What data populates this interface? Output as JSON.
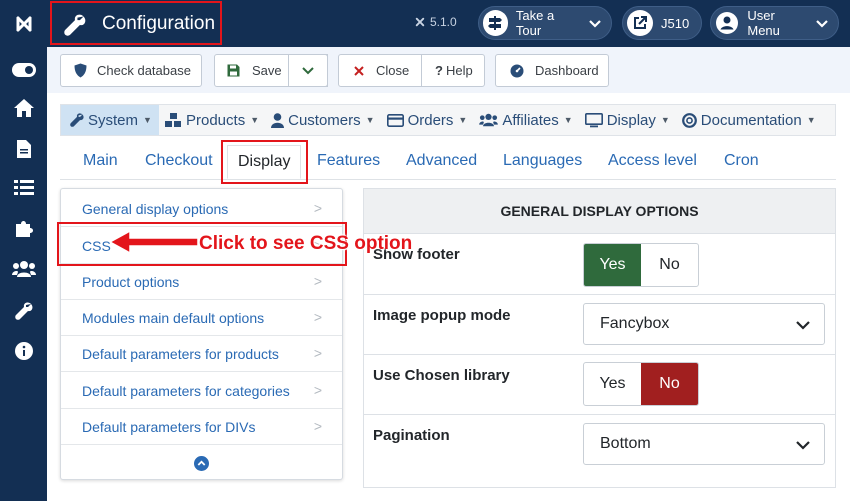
{
  "header": {
    "title": "Configuration",
    "version": "5.1.0",
    "take_tour": "Take a Tour",
    "site_name": "J510",
    "user_menu": "User Menu"
  },
  "toolbar": {
    "check_database": "Check database",
    "save": "Save",
    "close": "Close",
    "help": "Help",
    "dashboard": "Dashboard"
  },
  "menu": {
    "items": [
      {
        "label": "System",
        "icon": "wrench-icon"
      },
      {
        "label": "Products",
        "icon": "cubes-icon"
      },
      {
        "label": "Customers",
        "icon": "user-icon"
      },
      {
        "label": "Orders",
        "icon": "credit-card-icon"
      },
      {
        "label": "Affiliates",
        "icon": "users-icon"
      },
      {
        "label": "Display",
        "icon": "monitor-icon"
      },
      {
        "label": "Documentation",
        "icon": "life-ring-icon"
      }
    ]
  },
  "tabs": [
    "Main",
    "Checkout",
    "Display",
    "Features",
    "Advanced",
    "Languages",
    "Access level",
    "Cron"
  ],
  "sidenav": {
    "items": [
      "General display options",
      "CSS",
      "Product options",
      "Modules main default options",
      "Default parameters for products",
      "Default parameters for categories",
      "Default parameters for DIVs"
    ]
  },
  "options": {
    "heading": "GENERAL DISPLAY OPTIONS",
    "rows": [
      {
        "label": "Show footer",
        "yes": "Yes",
        "no": "No",
        "selected": "Yes"
      },
      {
        "label": "Image popup mode",
        "value": "Fancybox"
      },
      {
        "label": "Use Chosen library",
        "yes": "Yes",
        "no": "No",
        "selected": "No"
      },
      {
        "label": "Pagination",
        "value": "Bottom"
      }
    ]
  },
  "annotation": {
    "text": "Click to see CSS option"
  },
  "colors": {
    "sidebar": "#132f53",
    "highlight": "#e3151b",
    "yes_active": "#2f6a3c",
    "no_active": "#a11f1f",
    "link": "#2a6ab4"
  }
}
